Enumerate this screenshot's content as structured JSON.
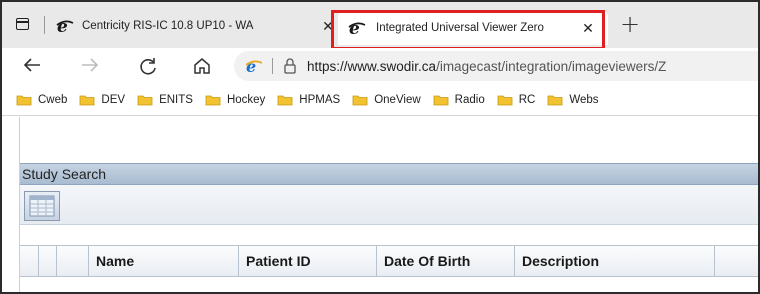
{
  "browser": {
    "tabs": [
      {
        "title": "Centricity RIS-IC 10.8 UP10 - WA",
        "close": "✕"
      },
      {
        "title": "Integrated Universal Viewer Zero",
        "close": "✕"
      }
    ],
    "new_tab": "+",
    "address": {
      "host": "https://www.swodir.ca",
      "path": "/imagecast/integration/imageviewers/Z"
    },
    "nav_icons": [
      "back-icon",
      "forward-icon",
      "refresh-icon",
      "home-icon"
    ],
    "bookmarks": [
      "Cweb",
      "DEV",
      "ENITS",
      "Hockey",
      "HPMAS",
      "OneView",
      "Radio",
      "RC",
      "Webs"
    ],
    "highlight_color": "#e02020",
    "folder_color": "#f2c230"
  },
  "app": {
    "panel_title": "Study Search",
    "columns": [
      "",
      "",
      "",
      "Name",
      "Patient ID",
      "Date Of Birth",
      "Description",
      ""
    ]
  }
}
